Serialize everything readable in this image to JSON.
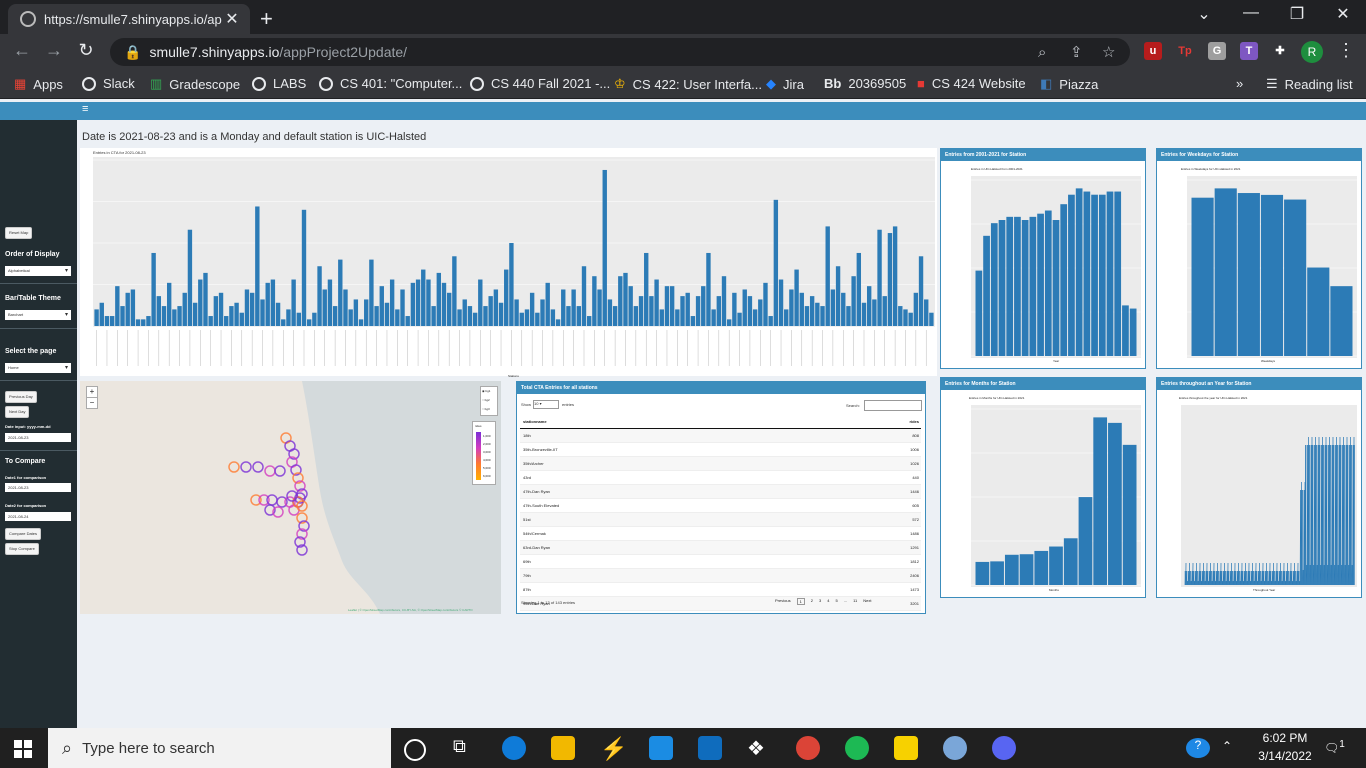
{
  "browser": {
    "tab_title": "https://smulle7.shinyapps.io/app",
    "tab_close": "✕",
    "new_tab": "+",
    "url_host": "smulle7.shinyapps.io",
    "url_path": "/appProject2Update/",
    "profile_initial": "R",
    "bookmarks": [
      "Apps",
      "Slack",
      "Gradescope",
      "LABS",
      "CS 401: \"Computer...",
      "CS 440 Fall 2021 -...",
      "CS 422: User Interfa...",
      "Jira",
      "20369505",
      "CS 424 Website",
      "Piazza"
    ],
    "bookmark_chevron": "»",
    "reading_list": "Reading list"
  },
  "app": {
    "hamburger": "≡",
    "info_line": "Date is 2021-08-23 and is a Monday and default station is UIC-Halsted",
    "sidebar": {
      "reset_map": "Reset Map",
      "order_label": "Order of Display",
      "order_value": "Alphabetical",
      "theme_label": "Bar/Table Theme",
      "theme_value": "Barchart",
      "page_label": "Select the page",
      "page_value": "Home",
      "prev_day": "Previous Day",
      "next_day": "Next Day",
      "date_input_label": "Date input: yyyy-mm-dd",
      "date_input_value": "2021-08-23",
      "compare_label": "To Compare",
      "date1_label": "Date1 for comparison",
      "date1_value": "2021-08-23",
      "date2_label": "Date2 for comparison",
      "date2_value": "2021-08-24",
      "compare_btn": "Compare Dates",
      "stop_btn": "Stop Compare"
    },
    "main_chart_title": "Entries in CTA for 2021-08-23",
    "main_chart_xlabel": "Stations",
    "main_chart_ylabel": "Total Rides",
    "panels": {
      "p1_title": "Entries from 2001-2021 for Station",
      "p1_chart": "Entries in UIC-Halsted from 2001-2021",
      "p1_x": "Year",
      "p2_title": "Entries for Weekdays for Station",
      "p2_chart": "Entries in Weekdays for UIC-Halsted in 2021",
      "p2_x": "Weekdays",
      "p3_title": "Entries for Months for Station",
      "p3_chart": "Entries in Months for UIC-Halsted in 2021",
      "p3_x": "Months",
      "p4_title": "Entries throughout an Year for Station",
      "p4_chart": "Entries throughout the year for UIC-Halsted in 2021",
      "p4_x": "Throughout Year",
      "y_label": "Total Rides"
    },
    "map": {
      "zoom_in": "+",
      "zoom_out": "−",
      "layers": [
        "bg1",
        "bg2",
        "bg3"
      ],
      "legend_title": "rides",
      "legend_values": [
        "1,000",
        "2,000",
        "3,000",
        "4,000",
        "5,000",
        "6,000"
      ],
      "attribution": "Leaflet | © OpenStreetMap contributors, CC-BY-SA, © OpenStreetMap contributors © CARTO"
    },
    "table": {
      "title": "Total CTA Entries for all stations",
      "show": "Show",
      "show_value": "10",
      "entries": "entries",
      "search": "Search:",
      "col1": "stationname",
      "col2": "rides",
      "rows": [
        [
          "18th",
          "808"
        ],
        [
          "35th-Bronzeville-IIT",
          "1006"
        ],
        [
          "35th/Archer",
          "1026"
        ],
        [
          "43rd",
          "440"
        ],
        [
          "47th-Dan Ryan",
          "1446"
        ],
        [
          "47th-South Elevated",
          "605"
        ],
        [
          "51st",
          "572"
        ],
        [
          "54th/Cermak",
          "1486"
        ],
        [
          "63rd-Dan Ryan",
          "1291"
        ],
        [
          "69th",
          "1812"
        ],
        [
          "79th",
          "2406"
        ],
        [
          "87th",
          "1473"
        ],
        [
          "95th/Dan Ryan",
          "3201"
        ]
      ],
      "showing": "Showing 1 to 13 of 143 entries",
      "pager": [
        "Previous",
        "1",
        "2",
        "3",
        "4",
        "5",
        "...",
        "11",
        "Next"
      ]
    }
  },
  "taskbar": {
    "search_placeholder": "Type here to search",
    "time": "6:02 PM",
    "date": "3/14/2022",
    "notifications": "1"
  },
  "chart_data": [
    {
      "type": "bar",
      "title": "Entries in CTA for 2021-08-23",
      "xlabel": "Stations",
      "ylabel": "Total Rides",
      "values": [
        5,
        7,
        3,
        3,
        12,
        6,
        10,
        11,
        2,
        2,
        3,
        22,
        9,
        6,
        13,
        5,
        6,
        10,
        29,
        7,
        14,
        16,
        3,
        9,
        10,
        3,
        6,
        7,
        4,
        11,
        10,
        36,
        8,
        13,
        14,
        7,
        2,
        5,
        14,
        4,
        35,
        2,
        4,
        18,
        11,
        14,
        6,
        20,
        11,
        5,
        8,
        2,
        8,
        20,
        6,
        12,
        7,
        14,
        5,
        11,
        3,
        13,
        14,
        17,
        14,
        6,
        16,
        13,
        10,
        21,
        5,
        8,
        6,
        4,
        14,
        6,
        9,
        11,
        7,
        17,
        25,
        8,
        4,
        5,
        10,
        4,
        8,
        13,
        5,
        2,
        11,
        6,
        11,
        6,
        18,
        3,
        15,
        11,
        47,
        8,
        6,
        15,
        16,
        12,
        6,
        9,
        22,
        9,
        14,
        5,
        12,
        12,
        5,
        9,
        10,
        3,
        9,
        12,
        22,
        5,
        9,
        15,
        2,
        10,
        4,
        11,
        9,
        5,
        8,
        13,
        3,
        38,
        14,
        5,
        11,
        17,
        10,
        6,
        9,
        7,
        6,
        30,
        11,
        18,
        10,
        6,
        15,
        22,
        7,
        12,
        8,
        29,
        9,
        28,
        30,
        6,
        5,
        4,
        10,
        21,
        8,
        4
      ]
    },
    {
      "type": "bar",
      "title": "Entries in UIC-Halsted from 2001-2021",
      "xlabel": "Year",
      "ylabel": "Total Rides",
      "values": [
        0.27,
        0.38,
        0.42,
        0.43,
        0.44,
        0.44,
        0.43,
        0.44,
        0.45,
        0.46,
        0.43,
        0.48,
        0.51,
        0.53,
        0.52,
        0.51,
        0.51,
        0.52,
        0.52,
        0.16,
        0.15
      ]
    },
    {
      "type": "bar",
      "title": "Entries in Weekdays for UIC-Halsted in 2021",
      "xlabel": "Weekdays",
      "ylabel": "Total Rides",
      "values": [
        17,
        18,
        17.5,
        17.3,
        16.8,
        9.5,
        7.5
      ]
    },
    {
      "type": "bar",
      "title": "Entries in Months for UIC-Halsted in 2021",
      "xlabel": "Months",
      "ylabel": "Total Rides",
      "values": [
        4.2,
        4.3,
        5.5,
        5.6,
        6.2,
        7,
        8.5,
        16,
        30.5,
        29.5,
        25.5
      ]
    }
  ]
}
